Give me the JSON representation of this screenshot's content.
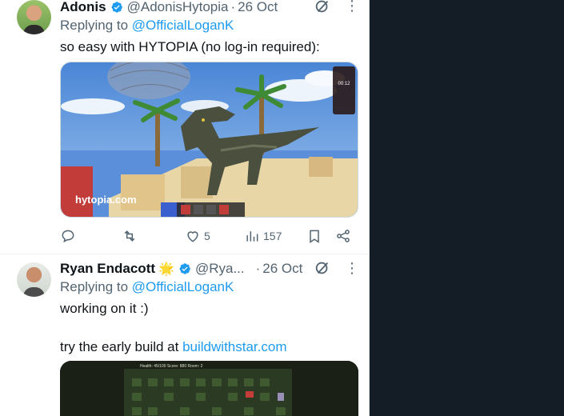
{
  "colors": {
    "link": "#1d9bf0",
    "muted": "#536471",
    "verified": "#1d9bf0",
    "background": "#ffffff",
    "dark_side": "#141c26"
  },
  "post1": {
    "name": "Adonis",
    "handle": "@AdonisHytopia",
    "dot": "·",
    "date": "26 Oct",
    "replying_prefix": "Replying to",
    "replying_handle": "@OfficialLoganK",
    "text": "so easy with HYTOPIA (no log-in required):",
    "media": {
      "watermark": "hytopia.com",
      "hud_timer": "00:12"
    },
    "actions": {
      "reply": {
        "icon": "reply-icon",
        "count": ""
      },
      "repost": {
        "icon": "repost-icon",
        "count": ""
      },
      "like": {
        "icon": "heart-icon",
        "count": "5"
      },
      "views": {
        "icon": "views-icon",
        "count": "157"
      },
      "bookmark": {
        "icon": "bookmark-icon"
      },
      "share": {
        "icon": "share-icon"
      }
    }
  },
  "post2": {
    "name": "Ryan Endacott",
    "emoji": "🌟",
    "handle": "@Rya...",
    "dot": "·",
    "date": "26 Oct",
    "replying_prefix": "Replying to",
    "replying_handle": "@OfficialLoganK",
    "text_line1": "working on it :)",
    "text_line2_prefix": "try the early build at",
    "text_line2_link": "buildwithstar.com",
    "media": {
      "hud_text": "Health: 45/100   Score: 880   Room: 2"
    }
  }
}
